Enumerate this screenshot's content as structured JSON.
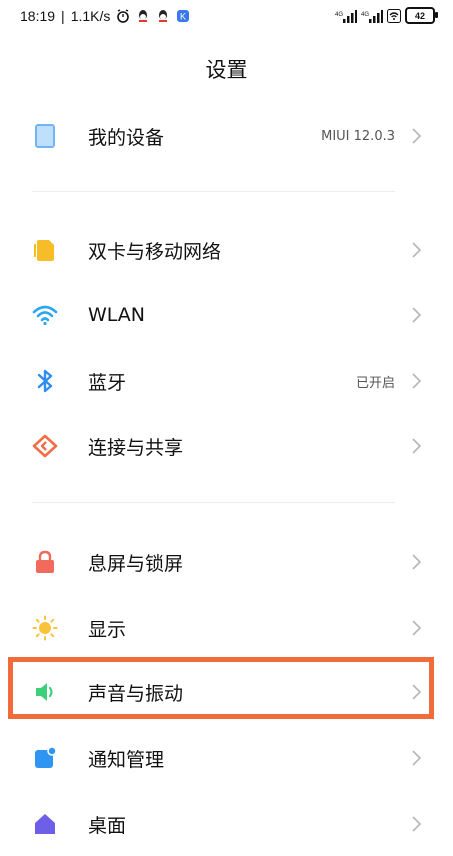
{
  "status_bar": {
    "time": "18:19",
    "speed": "1.1K/s",
    "separator": "|",
    "battery": "42",
    "signal_label": "4G"
  },
  "page_title": "设置",
  "items": [
    {
      "label": "我的设备",
      "value": "MIUI 12.0.3",
      "icon": "device-icon",
      "color": "#6fb7f4"
    },
    {
      "label": "双卡与移动网络",
      "value": "",
      "icon": "sim-card-icon",
      "color": "#f6bd29"
    },
    {
      "label": "WLAN",
      "value": "",
      "icon": "wifi-icon",
      "color": "#2aa7f0"
    },
    {
      "label": "蓝牙",
      "value": "已开启",
      "icon": "bluetooth-icon",
      "color": "#2f8cf0"
    },
    {
      "label": "连接与共享",
      "value": "",
      "icon": "share-icon",
      "color": "#f06e4a"
    },
    {
      "label": "息屏与锁屏",
      "value": "",
      "icon": "lock-icon",
      "color": "#f26a5c"
    },
    {
      "label": "显示",
      "value": "",
      "icon": "sun-icon",
      "color": "#f8c23a"
    },
    {
      "label": "声音与振动",
      "value": "",
      "icon": "speaker-icon",
      "color": "#3dd07a"
    },
    {
      "label": "通知管理",
      "value": "",
      "icon": "notification-icon",
      "color": "#2f95f2"
    },
    {
      "label": "桌面",
      "value": "",
      "icon": "home-icon",
      "color": "#6d5fe8"
    }
  ],
  "highlight_color": "#f26b3a"
}
